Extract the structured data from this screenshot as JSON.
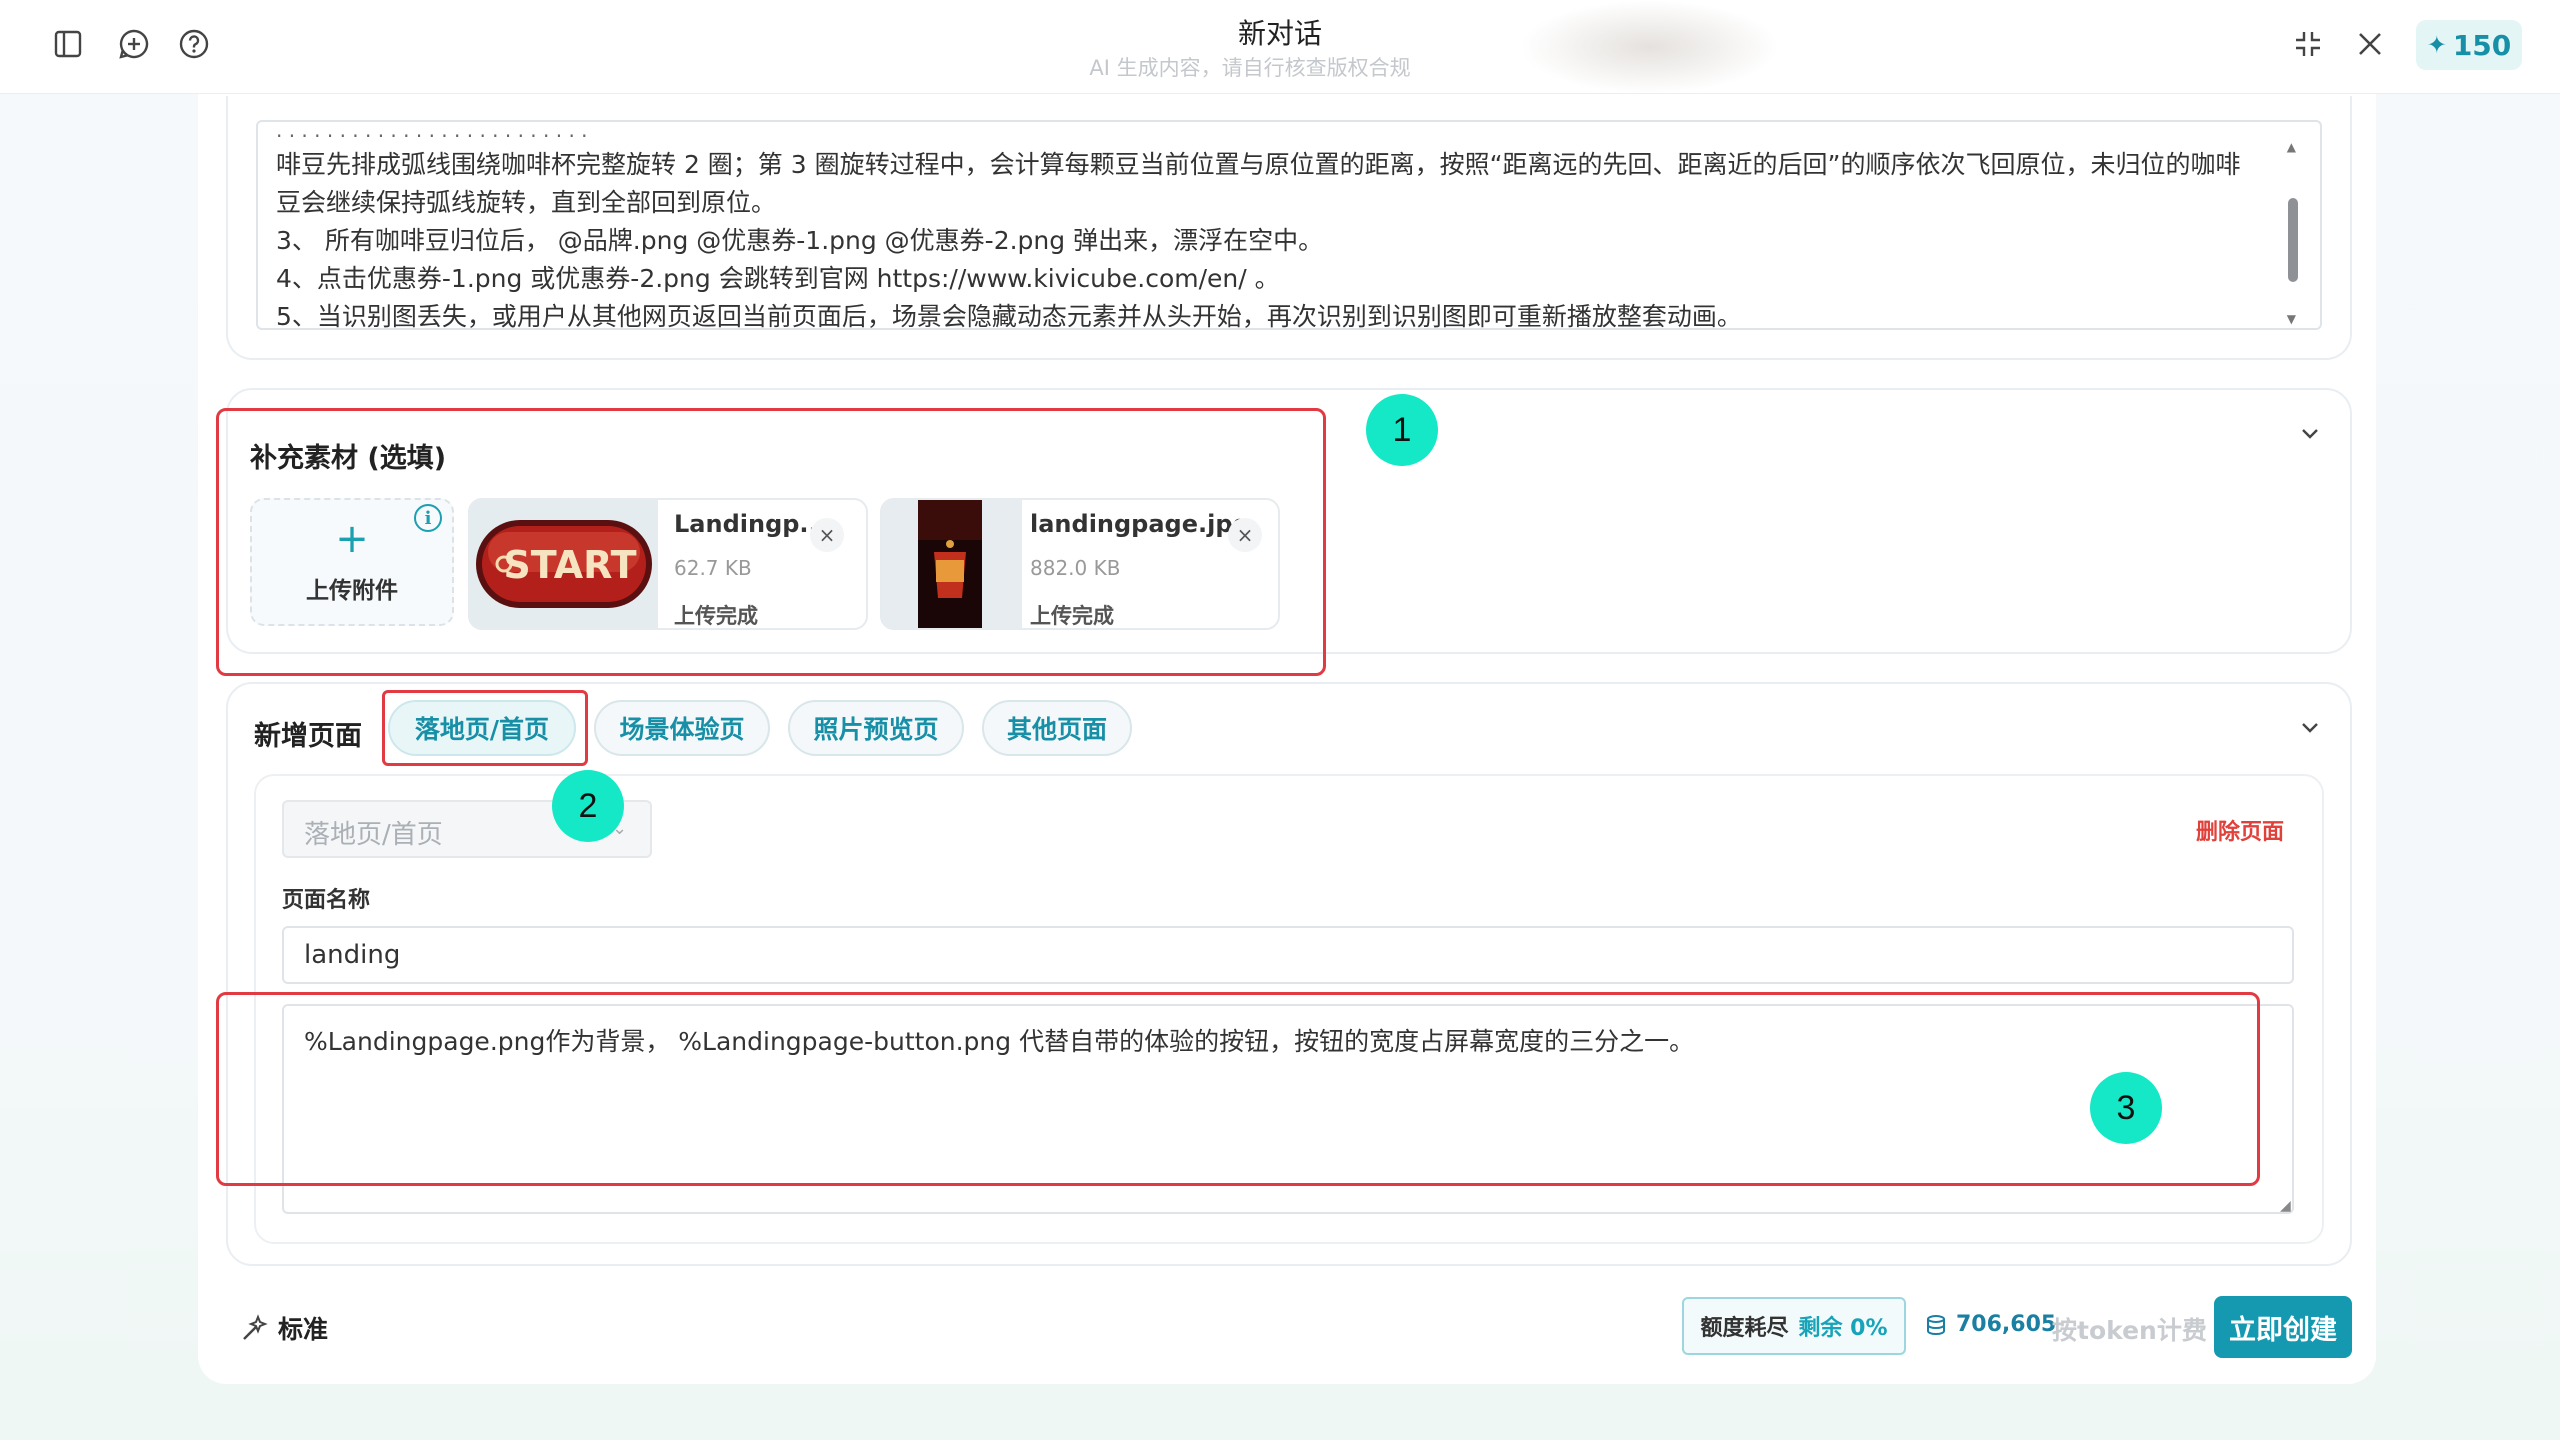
{
  "header": {
    "title": "新对话",
    "subtitle": "AI 生成内容，请自行核查版权合规",
    "credits": "150"
  },
  "description": {
    "lines": [
      "啡豆先排成弧线围绕咖啡杯完整旋转 2 圈；第 3 圈旋转过程中，会计算每颗豆当前位置与原位置的距离，按照“距离远的先回、距离近的后回”的顺序依次飞回原位，未归位的咖啡",
      "豆会继续保持弧线旋转，直到全部回到原位。",
      "3、 所有咖啡豆归位后， @品牌.png @优惠券-1.png @优惠券-2.png 弹出来，漂浮在空中。",
      "4、点击优惠券-1.png 或优惠券-2.png 会跳转到官网 https://www.kivicube.com/en/ 。",
      "5、当识别图丢失，或用户从其他网页返回当前页面后，场景会隐藏动态元素并从头开始，再次识别到识别图即可重新播放整套动画。"
    ]
  },
  "materials": {
    "title": "补充素材 (选填)",
    "upload_label": "上传附件",
    "files": [
      {
        "name": "Landingp...",
        "size": "62.7 KB",
        "status": "上传完成",
        "thumb_text": "START"
      },
      {
        "name": "landingpage.jpg",
        "size": "882.0 KB",
        "status": "上传完成"
      }
    ]
  },
  "new_page": {
    "title": "新增页面",
    "tabs": [
      "落地页/首页",
      "场景体验页",
      "照片预览页",
      "其他页面"
    ],
    "selected_type": "落地页/首页",
    "delete_label": "删除页面",
    "name_label": "页面名称",
    "name_value": "landing",
    "prompt": "%Landingpage.png作为背景， %Landingpage-button.png 代替自带的体验的按钮，按钮的宽度占屏幕宽度的三分之一。"
  },
  "annotations": [
    "1",
    "2",
    "3"
  ],
  "footer": {
    "mode": "标准",
    "quota_label": "额度耗尽",
    "quota_remaining": "剩余 0%",
    "tokens": "706,605",
    "billing": "按token计费",
    "create_label": "立即创建"
  },
  "colors": {
    "accent": "#1499b0",
    "annotation_red": "#e13a42",
    "badge_teal": "#14e8c6",
    "danger": "#e0413b"
  }
}
